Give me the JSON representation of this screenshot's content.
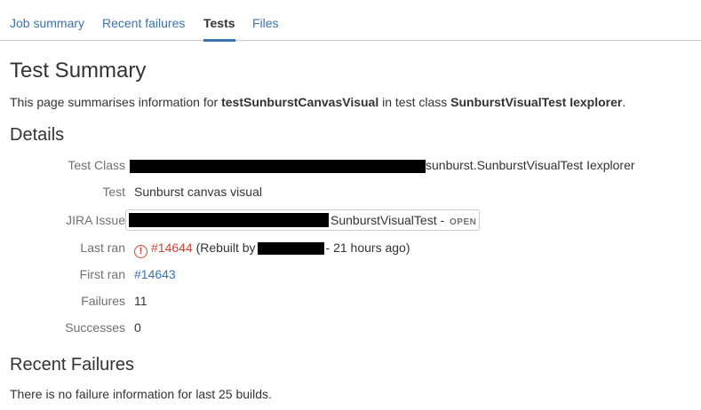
{
  "tabs": [
    {
      "label": "Job summary",
      "active": false
    },
    {
      "label": "Recent failures",
      "active": false
    },
    {
      "label": "Tests",
      "active": true
    },
    {
      "label": "Files",
      "active": false
    }
  ],
  "page": {
    "title": "Test Summary",
    "intro_prefix": "This page summarises information for ",
    "intro_test": "testSunburstCanvasVisual",
    "intro_mid": " in test class ",
    "intro_class": "SunburstVisualTest Iexplorer",
    "intro_suffix": "."
  },
  "details": {
    "heading": "Details",
    "test_class_label": "Test Class",
    "test_class_value": "sunburst.SunburstVisualTest Iexplorer",
    "test_label": "Test",
    "test_value": "Sunburst canvas visual",
    "jira_label": "JIRA Issue",
    "jira_value": "SunburstVisualTest -",
    "jira_status": "OPEN",
    "last_ran_label": "Last ran",
    "last_ran_icon": "error-circle-icon",
    "last_ran_build": "#14644",
    "last_ran_prefix": "(Rebuilt by",
    "last_ran_suffix": "- 21 hours ago)",
    "first_ran_label": "First ran",
    "first_ran_build": "#14643",
    "failures_label": "Failures",
    "failures_value": "11",
    "successes_label": "Successes",
    "successes_value": "0"
  },
  "recent_failures": {
    "heading": "Recent Failures",
    "message": "There is no failure information for last 25 builds."
  },
  "colors": {
    "link": "#3b73af",
    "error": "#d04437",
    "label": "#707070",
    "text": "#333333"
  }
}
